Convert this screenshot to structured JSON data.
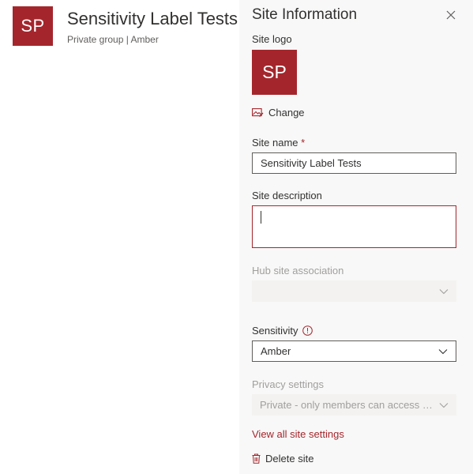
{
  "site": {
    "logo_initials": "SP",
    "title": "Sensitivity Label Tests",
    "subtitle": "Private group | Amber"
  },
  "panel": {
    "title": "Site Information",
    "logo_label": "Site logo",
    "logo_initials": "SP",
    "change_label": "Change",
    "site_name_label": "Site name",
    "required_mark": "*",
    "site_name_value": "Sensitivity Label Tests",
    "description_label": "Site description",
    "description_value": "",
    "hub_label": "Hub site association",
    "hub_value": "",
    "sensitivity_label": "Sensitivity",
    "sensitivity_value": "Amber",
    "privacy_label": "Privacy settings",
    "privacy_value": "Private - only members can access this...",
    "view_all_link": "View all site settings",
    "delete_label": "Delete site"
  },
  "icons": {
    "close": "close-icon",
    "change": "image-edit-icon",
    "info": "info-icon",
    "chevron": "chevron-down-icon",
    "delete": "trash-icon"
  },
  "colors": {
    "accent": "#a4262c",
    "panel_bg": "#f8f8f8",
    "disabled_text": "#a19f9d"
  }
}
